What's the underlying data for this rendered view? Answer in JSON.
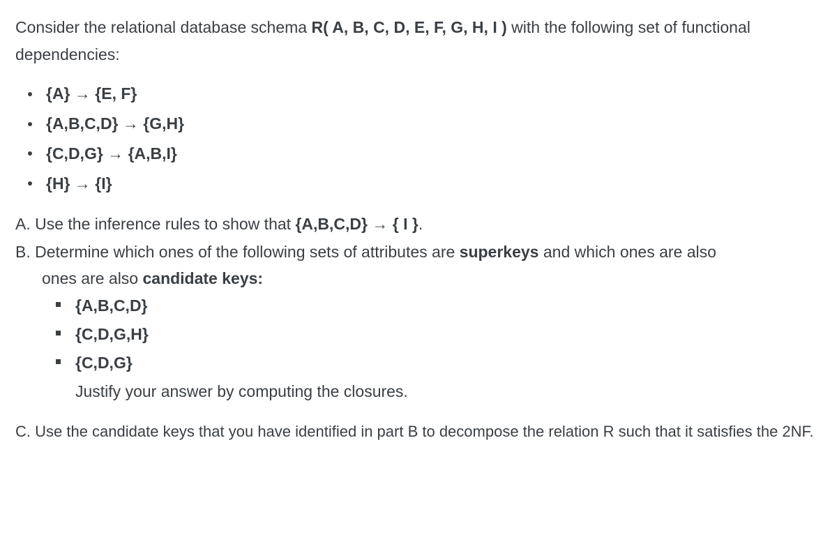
{
  "intro": {
    "pre": "Consider the relational database schema ",
    "schema": "R( A, B, C, D, E, F, G, H, I )",
    "post": " with the following set of functional dependencies:"
  },
  "fds": [
    {
      "lhs": "{A}",
      "rhs": "{E, F}"
    },
    {
      "lhs": "{A,B,C,D}",
      "rhs": "{G,H}"
    },
    {
      "lhs": "{C,D,G}",
      "rhs": "{A,B,I}"
    },
    {
      "lhs": "{H}",
      "rhs": "{I}"
    }
  ],
  "arrow": " → ",
  "partA": {
    "label": "A. ",
    "text_pre": "Use the inference rules to show that ",
    "fd_lhs": "{A,B,C,D}",
    "fd_rhs": "{ I }",
    "period": "."
  },
  "partB": {
    "label": "B. ",
    "text_pre": "Determine which ones of the following sets of attributes are ",
    "kw1": "superkeys",
    "text_mid": " and which ones are also ",
    "kw2": "candidate keys:",
    "options": [
      "{A,B,C,D}",
      "{C,D,G,H}",
      "{C,D,G}"
    ],
    "justify": "Justify your answer by computing the closures."
  },
  "partC": {
    "label": "C. ",
    "text": "Use the candidate keys that you have identified in part B to decompose the relation R such that it satisfies the 2NF."
  }
}
